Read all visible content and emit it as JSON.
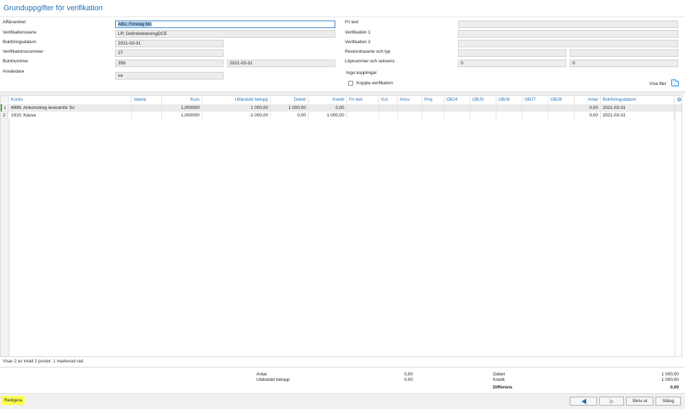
{
  "header": {
    "title": "Grunduppgifter för verifikation"
  },
  "form_left": [
    {
      "label": "Affärsenhet",
      "value": "AB1; Företag Mo"
    },
    {
      "label": "Verifikationsserie",
      "value": "LR; DefinitivbokningDCE"
    },
    {
      "label": "Bokföringsdatum",
      "value": "2021-03-31"
    },
    {
      "label": "Verifikationsnummer",
      "value": "27"
    },
    {
      "label": "Buntnummer",
      "value": "358",
      "value2": "2021-03-31"
    },
    {
      "label": "Användare",
      "value": "sa"
    }
  ],
  "form_right": {
    "fri_text": {
      "label": "Fri text",
      "value": ""
    },
    "verifikation1": {
      "label": "Verifikation 1",
      "value": ""
    },
    "verifikation2": {
      "label": "Verifikation 2",
      "value": ""
    },
    "reskontra": {
      "label": "Reskontraserie och typ",
      "value1": "",
      "value2": ""
    },
    "lopnummer": {
      "label": "Löpnummer och sekvens",
      "value1": "0",
      "value2": "0"
    },
    "kopplingar": "Inga kopplingar",
    "koppla_label": "Koppla verifikation",
    "visa_filer": "Visa filer"
  },
  "table": {
    "headers": [
      "Konto",
      "Valuta",
      "Kurs",
      "Utländskt belopp",
      "Debet",
      "Kredit",
      "Fri text",
      "Kst",
      "Ansv",
      "Proj",
      "OBJ4",
      "OBJ5",
      "OBJ6",
      "OBJ7",
      "OBJ8",
      "Antal",
      "Bokföringsdatum"
    ],
    "rows": [
      {
        "num": "1",
        "cells": [
          "4999; Ankomstreg leverantör Sv",
          "",
          "1,000000",
          "1 000,00",
          "1 000,00",
          "0,00",
          "",
          "",
          "",
          "",
          "",
          "",
          "",
          "",
          "",
          "0,00",
          "2021-03-31"
        ]
      },
      {
        "num": "2",
        "cells": [
          "1910; Kassa",
          "",
          "1,000000",
          "-1 000,00",
          "0,00",
          "1 000,00",
          "",
          "",
          "",
          "",
          "",
          "",
          "",
          "",
          "",
          "0,00",
          "2021-03-31"
        ]
      }
    ]
  },
  "status": "Visar 2 av totalt 2 poster. 1 markerad rad",
  "totals": {
    "antal_label": "Antal",
    "antal_value": "0,00",
    "utl_label": "Utländskt belopp",
    "utl_value": "0,00",
    "debet_label": "Debet",
    "debet_value": "1 000,00",
    "kredit_label": "Kredit",
    "kredit_value": "1 000,00",
    "diff_label": "Differens",
    "diff_value": "0,00"
  },
  "footer": {
    "redigera": "Redigera",
    "skriv_ut": "Skriv ut",
    "stang": "Stäng"
  },
  "colors": {
    "accent": "#1f6fb5",
    "highlight": "#ffff4d"
  }
}
